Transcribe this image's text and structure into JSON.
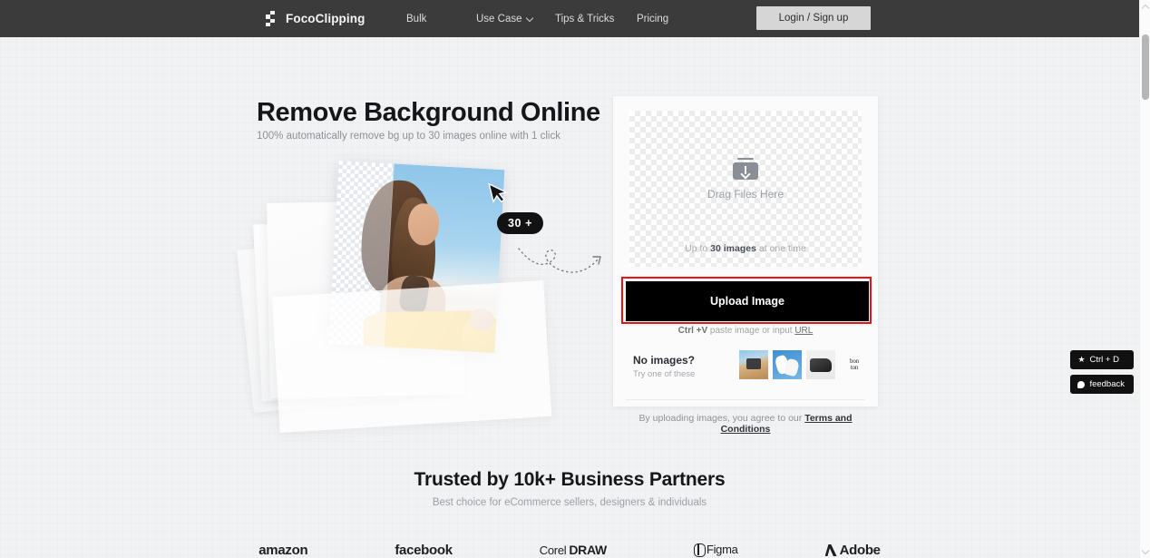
{
  "header": {
    "logo_text": "FocoClipping",
    "nav": [
      {
        "label": "Bulk",
        "has_chevron": false
      },
      {
        "label": "Use Case",
        "has_chevron": true
      },
      {
        "label": "Tips & Tricks",
        "has_chevron": false
      },
      {
        "label": "Pricing",
        "has_chevron": false
      }
    ],
    "login_label": "Login / Sign up"
  },
  "hero": {
    "title": "Remove Background Online",
    "subtitle": "100% automatically remove bg up to 30 images online with 1 click",
    "badge": "30 +"
  },
  "panel": {
    "dropzone": {
      "label": "Drag Files Here",
      "limit_prefix": "Up to ",
      "limit_strong": "30 images",
      "limit_suffix": " at one time"
    },
    "upload_button": "Upload Image",
    "paste_hint": {
      "shortcut": "Ctrl +V",
      "text": " paste image or input ",
      "link": "URL"
    },
    "samples": {
      "title": "No images?",
      "subtitle": "Try one of these",
      "thumbs": [
        {
          "name": "woman-with-camera"
        },
        {
          "name": "white-sneakers"
        },
        {
          "name": "black-camera"
        },
        {
          "name": "bon-ton-logo",
          "line1": "bon",
          "line2": "ton"
        }
      ]
    },
    "terms": {
      "text": "By uploading images, you agree to our ",
      "link": "Terms and Conditions"
    }
  },
  "trusted": {
    "title": "Trusted by 10k+ Business Partners",
    "subtitle": "Best choice for eCommerce sellers, designers & individuals",
    "partners": [
      {
        "name": "amazon",
        "label": "amazon"
      },
      {
        "name": "facebook",
        "label": "facebook"
      },
      {
        "name": "coreldraw",
        "label_light": "Corel ",
        "label_bold": "DRAW"
      },
      {
        "name": "figma",
        "label": "Figma"
      },
      {
        "name": "adobe",
        "label": "Adobe"
      }
    ]
  },
  "floating": {
    "bookmark": "Ctrl + D",
    "feedback": "feedback"
  },
  "colors": {
    "header_bg": "#3b3b3b",
    "page_bg": "#f1f2f4",
    "accent_black": "#000000",
    "annotation_red": "#ee1111",
    "badge_black": "#121212"
  }
}
